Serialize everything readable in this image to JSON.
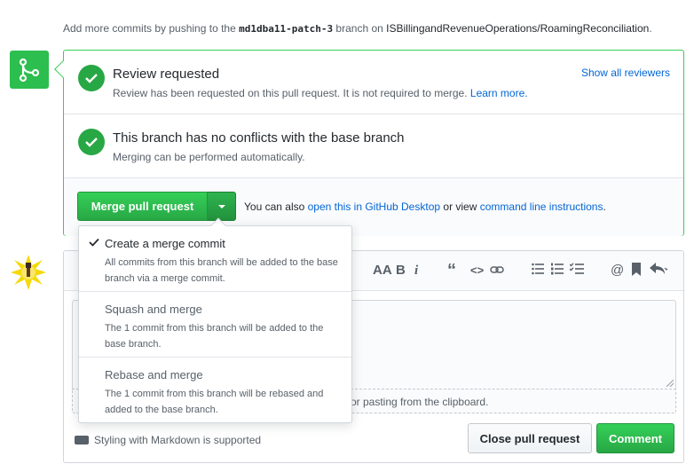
{
  "top_note": {
    "prefix": "Add more commits by pushing to the",
    "branch": "md1dba11-patch-3",
    "middle": "branch on",
    "repo": "ISBillingandRevenueOperations/RoamingReconciliation",
    "suffix": "."
  },
  "review": {
    "title": "Review requested",
    "subtitle": "Review has been requested on this pull request. It is not required to merge.",
    "learn_more": "Learn more.",
    "show_all": "Show all reviewers"
  },
  "conflicts": {
    "title": "This branch has no conflicts with the base branch",
    "subtitle": "Merging can be performed automatically."
  },
  "merge": {
    "button_label": "Merge pull request",
    "also_prefix": "You can also",
    "desktop_link": "open this in GitHub Desktop",
    "or_view": "or view",
    "cli_link": "command line instructions",
    "suffix": "."
  },
  "dropdown": {
    "items": [
      {
        "title": "Create a merge commit",
        "desc": "All commits from this branch will be added to the base branch via a merge commit.",
        "selected": true
      },
      {
        "title": "Squash and merge",
        "desc": "The 1 commit from this branch will be added to the base branch.",
        "selected": false
      },
      {
        "title": "Rebase and merge",
        "desc": "The 1 commit from this branch will be rebased and added to the base branch.",
        "selected": false
      }
    ]
  },
  "toolbar": {
    "header_label": "AA",
    "bold_label": "B",
    "italic_label": "i",
    "quote_label": "“",
    "code_label": "<>",
    "mention_label": "@"
  },
  "editor": {
    "drop_hint": "or pasting from the clipboard.",
    "markdown_note": "Styling with Markdown is supported",
    "close_label": "Close pull request",
    "comment_label": "Comment"
  },
  "colors": {
    "success": "#28a745",
    "link": "#0366d6",
    "border_green": "#34d058"
  }
}
